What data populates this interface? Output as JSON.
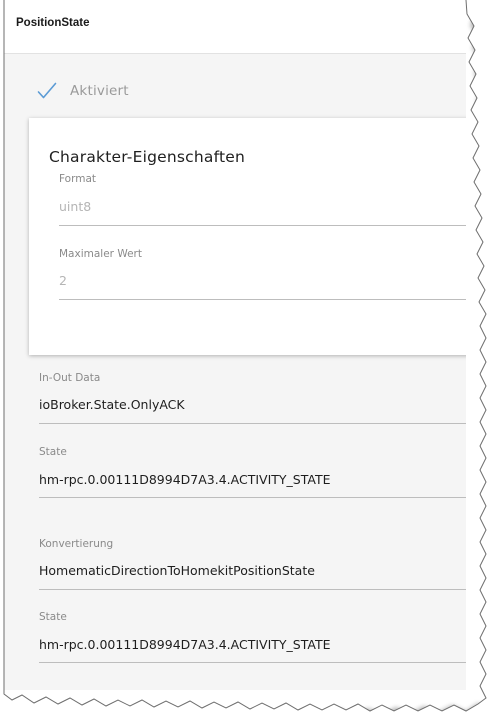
{
  "header": {
    "title": "PositionState"
  },
  "activation": {
    "label": "Aktiviert",
    "checked": true,
    "icon": "checkmark-icon",
    "accent_color": "#5b9bd5"
  },
  "characteristic_card": {
    "title": "Charakter-Eigenschaften",
    "fields": [
      {
        "label": "Format",
        "value": "uint8"
      },
      {
        "label": "Maximaler Wert",
        "value": "2"
      }
    ]
  },
  "fields": [
    {
      "label": "In-Out Data",
      "value": "ioBroker.State.OnlyACK"
    },
    {
      "label": "State",
      "value": "hm-rpc.0.00111D8994D7A3.4.ACTIVITY_STATE"
    },
    {
      "label": "Konvertierung",
      "value": "HomematicDirectionToHomekitPositionState"
    },
    {
      "label": "State",
      "value": "hm-rpc.0.00111D8994D7A3.4.ACTIVITY_STATE"
    }
  ]
}
